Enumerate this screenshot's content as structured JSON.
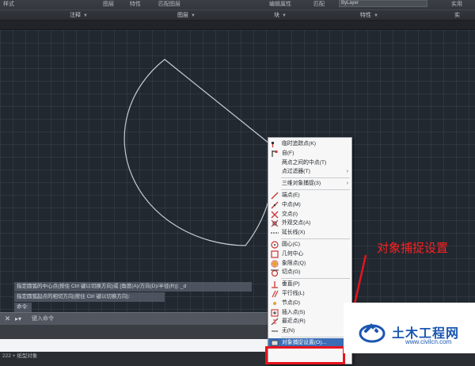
{
  "ribbon": {
    "top_labels": [
      "样式",
      "图层",
      "特性",
      "匹配图层",
      "编辑属性",
      "匹配",
      "ByLayer",
      "实用"
    ],
    "panels": [
      "注释",
      "图层",
      "块",
      "特性",
      "实"
    ]
  },
  "command_history": [
    "指定圆弧的中心点(按住 Ctrl 键以切换方向)或 [角度(A)/方向(D)/半径(R)]: _d",
    "指定圆弧起点的相切方向(按住 Ctrl 键以切换方向):",
    "命令:"
  ],
  "command_input": {
    "placeholder": "键入命令"
  },
  "status_bar": {
    "text": "222 + 纸型对象"
  },
  "context_menu": {
    "groups": [
      [
        {
          "label": "临时追踪点(K)",
          "icon": "temp-track-icon"
        },
        {
          "label": "自(F)",
          "icon": "from-icon"
        },
        {
          "label": "两点之间的中点(T)",
          "icon": ""
        },
        {
          "label": "点过滤器(T)",
          "icon": "",
          "submenu": true
        }
      ],
      [
        {
          "label": "三维对象捕捉(3)",
          "icon": "",
          "submenu": true
        }
      ],
      [
        {
          "label": "端点(E)",
          "icon": "endpoint-icon"
        },
        {
          "label": "中点(M)",
          "icon": "midpoint-icon"
        },
        {
          "label": "交点(I)",
          "icon": "intersection-icon"
        },
        {
          "label": "外观交点(A)",
          "icon": "apparent-intersection-icon"
        },
        {
          "label": "延长线(X)",
          "icon": "extension-icon"
        }
      ],
      [
        {
          "label": "圆心(C)",
          "icon": "center-icon"
        },
        {
          "label": "几何中心",
          "icon": "geometric-center-icon"
        },
        {
          "label": "象限点(Q)",
          "icon": "quadrant-icon"
        },
        {
          "label": "切点(G)",
          "icon": "tangent-icon"
        }
      ],
      [
        {
          "label": "垂直(P)",
          "icon": "perpendicular-icon"
        },
        {
          "label": "平行线(L)",
          "icon": "parallel-icon"
        },
        {
          "label": "节点(D)",
          "icon": "node-icon"
        },
        {
          "label": "插入点(S)",
          "icon": "insert-icon"
        },
        {
          "label": "最近点(R)",
          "icon": "nearest-icon"
        },
        {
          "label": "无(N)",
          "icon": "none-icon"
        }
      ],
      [
        {
          "label": "对象捕捉设置(O)...",
          "icon": "osnap-settings-icon",
          "highlight": true
        }
      ]
    ]
  },
  "annotation": {
    "text": "对象捕捉设置"
  },
  "watermark": {
    "title": "土木工程网",
    "url": "www.civilcn.com"
  },
  "colors": {
    "canvas": "#212830",
    "annotation": "#ff1f1f",
    "highlight": "#3a6db5",
    "watermark": "#1a56b0"
  }
}
